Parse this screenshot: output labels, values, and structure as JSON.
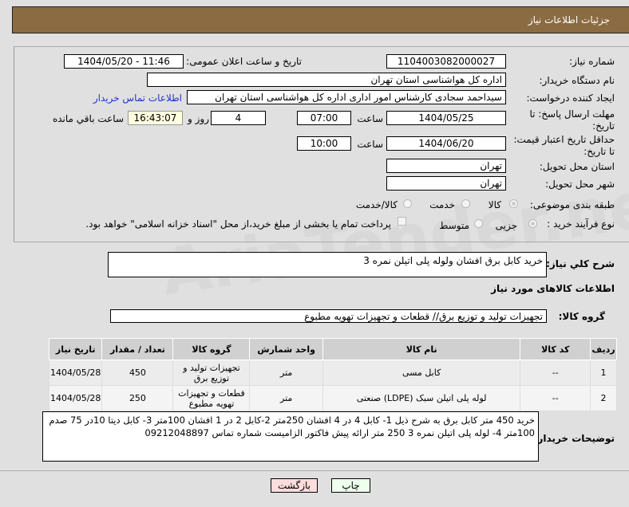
{
  "header": {
    "title": "جزئیات اطلاعات نیاز"
  },
  "watermark": "AriaTender.net",
  "form": {
    "need_number_label": "شماره نیاز:",
    "need_number": "1104003082000027",
    "announce_label": "تاریخ و ساعت اعلان عمومی:",
    "announce_value": "1404/05/20 - 11:46",
    "buyer_org_label": "نام دستگاه خریدار:",
    "buyer_org": "اداره کل هواشناسی استان تهران",
    "requester_label": "ایجاد کننده درخواست:",
    "requester": "سیداحمد سجادی کارشناس امور اداری اداره کل هواشناسی استان تهران",
    "contact_link": "اطلاعات تماس خریدار",
    "deadline_label_1": "مهلت ارسال پاسخ: تا",
    "deadline_label_2": "تاریخ:",
    "deadline_date": "1404/05/25",
    "time_label": "ساعت",
    "deadline_time": "07:00",
    "days": "4",
    "days_label": "روز و",
    "remaining_time": "16:43:07",
    "remaining_label": "ساعت باقي مانده",
    "validity_label_1": "حداقل تاریخ اعتبار قیمت:",
    "validity_label_2": "تا تاریخ:",
    "validity_date": "1404/06/20",
    "validity_time": "10:00",
    "province_label": "استان محل تحویل:",
    "province": "تهران",
    "city_label": "شهر محل تحویل:",
    "city": "تهران",
    "category_label": "طبقه بندی موضوعی:",
    "category_options": [
      "کالا",
      "خدمت",
      "کالا/خدمت"
    ],
    "category_selected": "کالا",
    "process_label": "نوع فرآیند خرید :",
    "process_options": [
      "جزیی",
      "متوسط"
    ],
    "process_selected": "جزیی",
    "payment_note": "پرداخت تمام یا بخشی از مبلغ خرید،از محل \"اسناد خزانه اسلامی\" خواهد بود."
  },
  "summary": {
    "label": "شرح کلي نياز:",
    "value": "خرید کابل برق افشان ولوله پلی اتیلن نمره 3"
  },
  "items_section": {
    "title": "اطلاعات کالاهای مورد نیاز",
    "group_label": "گروه کالا:",
    "group_value": "تجهیزات تولید و توزیع برق//  قطعات و تجهیزات تهویه مطبوع"
  },
  "table": {
    "headers": [
      "ردیف",
      "کد کالا",
      "نام کالا",
      "واحد شمارش",
      "گروه کالا",
      "تعداد / مقدار",
      "تاریخ نیاز"
    ],
    "rows": [
      [
        "1",
        "--",
        "کابل مسی",
        "متر",
        "تجهیزات تولید و توزیع برق",
        "450",
        "1404/05/28"
      ],
      [
        "2",
        "--",
        "لوله پلی اتیلن سبک (LDPE) صنعتی",
        "متر",
        "قطعات و تجهیزات تهویه مطبوع",
        "250",
        "1404/05/28"
      ]
    ]
  },
  "buyer_notes": {
    "label": "توضیحات خریدار:",
    "value": "خرید  450 متر کابل برق  به شرح ذیل 1- کابل 4 در 4 افشان 250متر 2-کابل 2 در 1  افشان 100متر 3- کابل دیتا 10در 75 صدم 100متر  4- لوله پلی اتیلن نمره 3  250 متر ارائه پیش فاکتور الزامیست شماره تماس 09212048897"
  },
  "buttons": {
    "print": "چاپ",
    "back": "بازگشت"
  },
  "colors": {
    "header": "#8b6b42",
    "back_button": "#ffdddd",
    "print_button": "#eeffee",
    "link": "#2233cc",
    "remaining_bg": "#ffffe0"
  }
}
